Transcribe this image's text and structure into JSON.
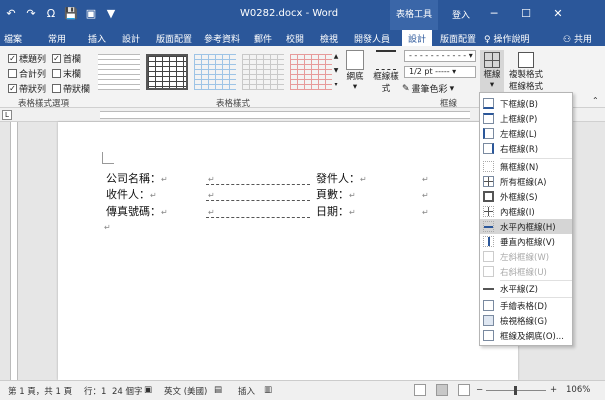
{
  "titlebar": {
    "qat": [
      "↶",
      "↷",
      "Ω",
      "💾",
      "▣",
      "▼"
    ],
    "title": "W0282.docx - Word",
    "context_tab": "表格工具",
    "login": "登入",
    "min": "─",
    "restore": "☐",
    "close": "✕"
  },
  "tabs": {
    "items": [
      "檔案",
      "常用",
      "插入",
      "設計",
      "版面配置",
      "參考資料",
      "郵件",
      "校閱",
      "檢視",
      "開發人員",
      "設計",
      "版面配置"
    ],
    "active_index": 10,
    "tell_me": "操作說明",
    "share": "共用"
  },
  "ribbon": {
    "options": {
      "header_row": "標題列",
      "first_col": "首欄",
      "total_row": "合計列",
      "last_col": "末欄",
      "banded_rows": "帶狀列",
      "banded_cols": "帶狀欄"
    },
    "checked": {
      "header_row": true,
      "first_col": true,
      "total_row": false,
      "last_col": false,
      "banded_rows": true,
      "banded_cols": false
    },
    "group_options_label": "表格樣式選項",
    "group_styles_label": "表格樣式",
    "group_borders_label": "框線",
    "shading_label": "網底",
    "border_styles_label": "框線樣式",
    "pen_weight": "1/2 pt",
    "pen_color_label": "畫筆色彩",
    "borders_label": "框線",
    "painter_label": "複製格式",
    "painter_label2": "框線格式"
  },
  "document": {
    "left_labels": [
      "公司名稱：",
      "收件人：",
      "傳真號碼："
    ],
    "right_labels": [
      "發件人：",
      "頁數：",
      "日期："
    ],
    "para_mark": "↵"
  },
  "dropdown": {
    "items": [
      {
        "label": "下框線(B)",
        "disabled": false
      },
      {
        "label": "上框線(P)",
        "disabled": false
      },
      {
        "label": "左框線(L)",
        "disabled": false
      },
      {
        "label": "右框線(R)",
        "disabled": false
      },
      {
        "label": "無框線(N)",
        "disabled": false
      },
      {
        "label": "所有框線(A)",
        "disabled": false
      },
      {
        "label": "外框線(S)",
        "disabled": false
      },
      {
        "label": "內框線(I)",
        "disabled": false
      },
      {
        "label": "水平內框線(H)",
        "disabled": false
      },
      {
        "label": "垂直內框線(V)",
        "disabled": false
      },
      {
        "label": "左斜框線(W)",
        "disabled": true
      },
      {
        "label": "右斜框線(U)",
        "disabled": true
      },
      {
        "label": "水平線(Z)",
        "disabled": false
      },
      {
        "label": "手繪表格(D)",
        "disabled": false
      },
      {
        "label": "檢視格線(G)",
        "disabled": false
      },
      {
        "label": "框線及網底(O)...",
        "disabled": false
      }
    ],
    "highlighted_index": 8
  },
  "statusbar": {
    "page": "第 1 頁，共 1 頁",
    "line": "行：1",
    "words": "24 個字",
    "lang": "英文 (美國)",
    "mode": "插入",
    "zoom": "106%",
    "zoom_minus": "−",
    "zoom_plus": "+"
  }
}
